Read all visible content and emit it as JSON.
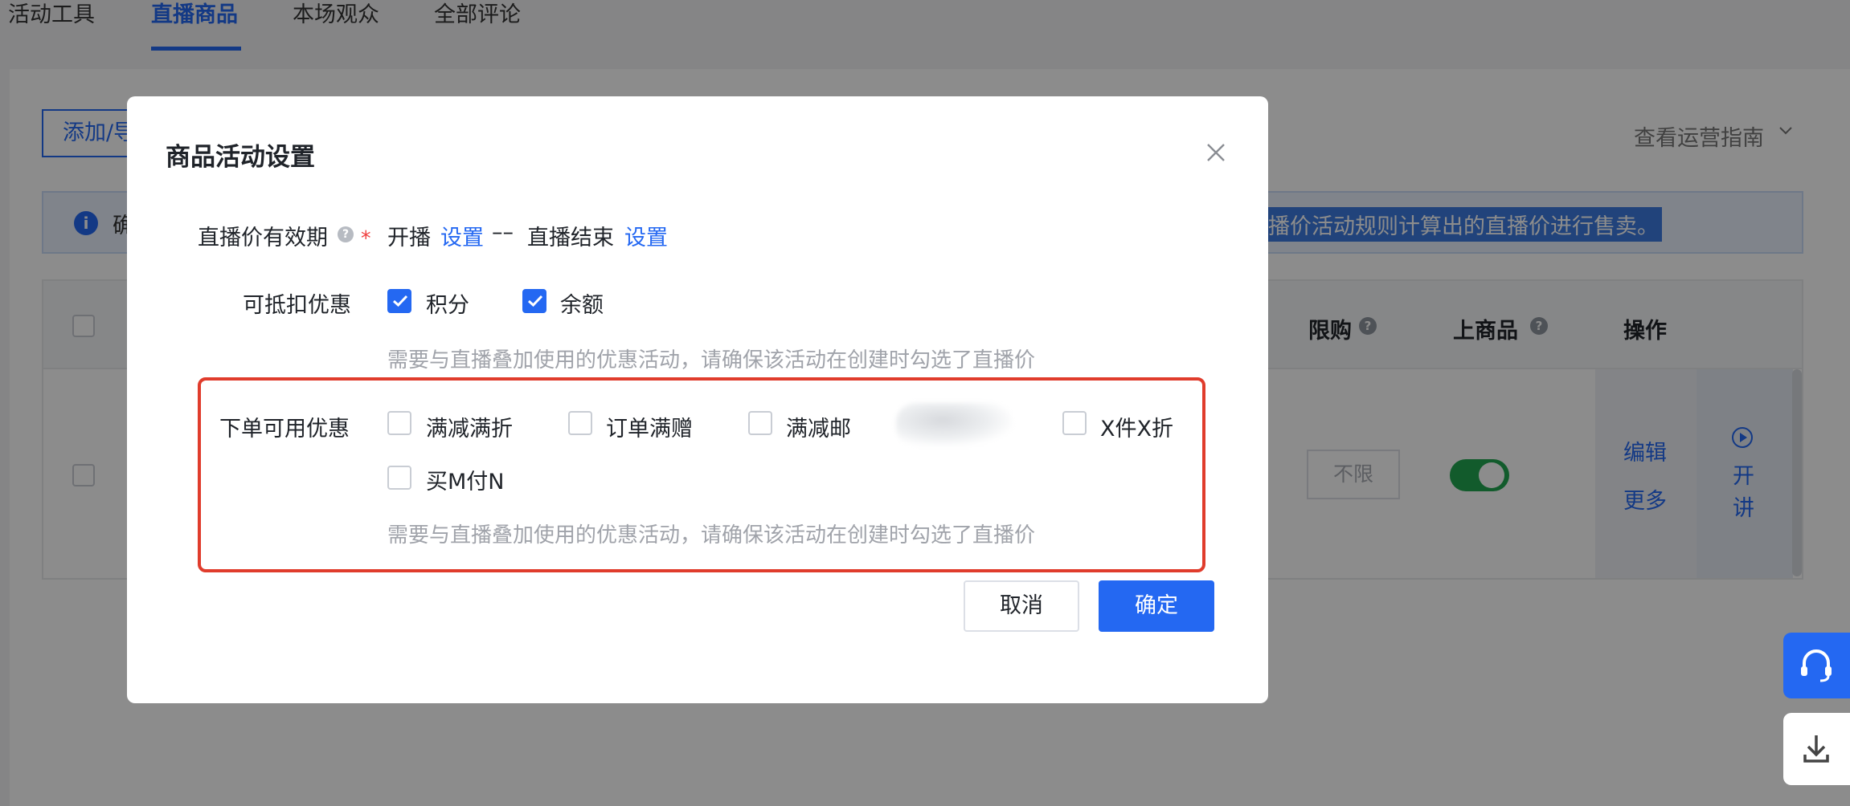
{
  "tabs": [
    "活动工具",
    "直播商品",
    "本场观众",
    "全部评论"
  ],
  "toolbar": {
    "add_button": "添加/导",
    "guide_link": "查看运营指南"
  },
  "banner": {
    "left_text": "确",
    "right_text": "播价活动规则计算出的直播价进行售卖。"
  },
  "table": {
    "headers": {
      "limit": "限购",
      "on_shelf": "上商品",
      "actions": "操作"
    },
    "row": {
      "limit_value": "不限",
      "on_shelf": true,
      "edit": "编辑",
      "more": "更多",
      "talk": "开讲"
    }
  },
  "modal": {
    "title": "商品活动设置",
    "validity": {
      "label": "直播价有效期",
      "start_label": "开播",
      "start_link": "设置",
      "separator": "––",
      "end_label": "直播结束",
      "end_link": "设置"
    },
    "deductible": {
      "label": "可抵扣优惠",
      "options": [
        {
          "label": "积分",
          "checked": true
        },
        {
          "label": "余额",
          "checked": true
        }
      ],
      "hint": "需要与直播叠加使用的优惠活动，请确保该活动在创建时勾选了直播价"
    },
    "order_discounts": {
      "label": "下单可用优惠",
      "options": [
        {
          "label": "满减满折",
          "checked": false
        },
        {
          "label": "订单满赠",
          "checked": false
        },
        {
          "label": "满减邮",
          "checked": false
        },
        {
          "label": "X件X折",
          "checked": false
        },
        {
          "label": "买M付N",
          "checked": false
        }
      ],
      "hint": "需要与直播叠加使用的优惠活动，请确保该活动在创建时勾选了直播价"
    },
    "buttons": {
      "cancel": "取消",
      "ok": "确定"
    }
  },
  "colors": {
    "primary": "#2468f2",
    "highlight_border": "#e03c2c",
    "required": "#f03e3e",
    "toggle_on": "#22a650"
  }
}
